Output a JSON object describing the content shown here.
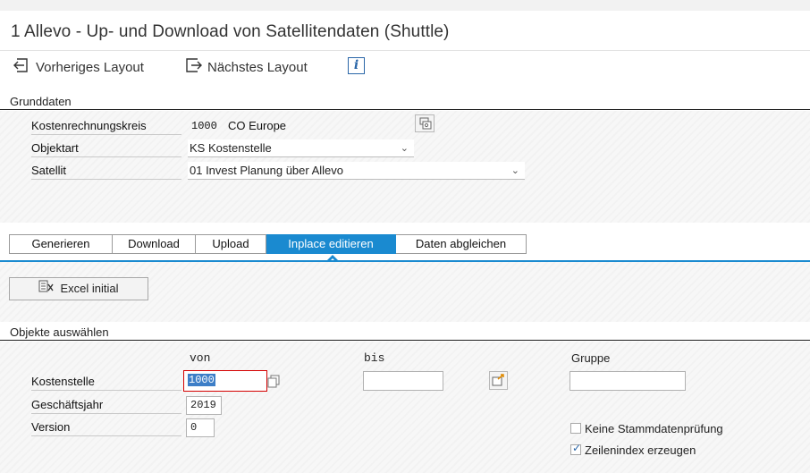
{
  "window": {
    "title": "1 Allevo - Up- und Download von Satellitendaten (Shuttle)"
  },
  "toolbar": {
    "prev_layout": "Vorheriges Layout",
    "next_layout": "Nächstes Layout",
    "info_glyph": "i"
  },
  "grunddaten": {
    "header": "Grunddaten",
    "fields": {
      "kostenrechnungskreis": {
        "label": "Kostenrechnungskreis",
        "code": "1000",
        "text": "CO Europe"
      },
      "objektart": {
        "label": "Objektart",
        "value": "KS Kostenstelle"
      },
      "satellit": {
        "label": "Satellit",
        "value": "01 Invest Planung über Allevo"
      }
    }
  },
  "tabs": [
    {
      "label": "Generieren",
      "active": false
    },
    {
      "label": "Download",
      "active": false
    },
    {
      "label": "Upload",
      "active": false
    },
    {
      "label": "Inplace editieren",
      "active": true
    },
    {
      "label": "Daten abgleichen",
      "active": false
    }
  ],
  "actions": {
    "excel_initial": "Excel initial"
  },
  "objekte": {
    "header": "Objekte auswählen",
    "col_von": "von",
    "col_bis": "bis",
    "col_gruppe": "Gruppe",
    "kostenstelle": {
      "label": "Kostenstelle",
      "von": "1000",
      "bis": "",
      "gruppe": ""
    },
    "geschaeftsjahr": {
      "label": "Geschäftsjahr",
      "value": "2019"
    },
    "version": {
      "label": "Version",
      "value": "0"
    },
    "keine_stammdaten": {
      "label": "Keine Stammdatenprüfung",
      "checked": false
    },
    "zeilenindex": {
      "label": "Zeilenindex erzeugen",
      "checked": true
    }
  },
  "colors": {
    "accent": "#1a8ad0",
    "focus_border": "#d40000",
    "selection": "#3d7ec7"
  }
}
